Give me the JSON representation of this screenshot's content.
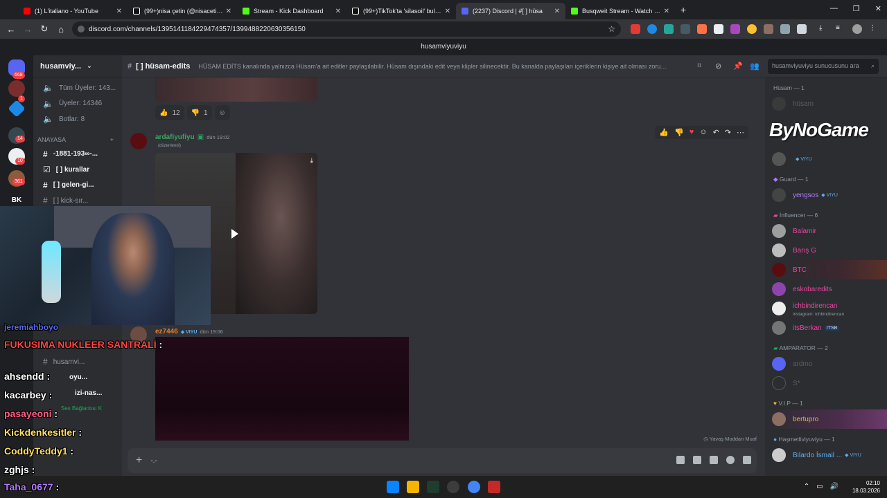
{
  "browser": {
    "tabs": [
      {
        "title": "(1) L'italiano - YouTube",
        "color": "#ff0000"
      },
      {
        "title": "(99+)nisa çetin (@nisacetin0_) |",
        "color": "#111111"
      },
      {
        "title": "Stream - Kick Dashboard",
        "color": "#53fc18"
      },
      {
        "title": "(99+)TikTok'ta 'silasoil' bulabili",
        "color": "#111111"
      },
      {
        "title": "(2237) Discord | #[ ] hüsa",
        "color": "#5865f2"
      },
      {
        "title": "Busqweit Stream - Watch Live o",
        "color": "#53fc18"
      }
    ],
    "url": "discord.com/channels/1395141184229474357/1399488220630356150"
  },
  "discord": {
    "window_title": "husamviyuviyu",
    "server_name": "husamviy...",
    "channels": [
      {
        "label": "Tüm Üyeler: 143..."
      },
      {
        "label": "Üyeler: 14346"
      },
      {
        "label": "Botlar: 8"
      }
    ],
    "category": "ANAYASA",
    "text_channels": [
      {
        "label": "-1881-193∞-..."
      },
      {
        "label": "[ ] kurallar"
      },
      {
        "label": "[ ] gelen-gi..."
      },
      {
        "label": "[ ] kick-sır..."
      }
    ],
    "lower_channels": [
      {
        "label": "husamvi..."
      },
      {
        "label": "oyu..."
      },
      {
        "label": "izi-nas..."
      }
    ],
    "voice_status": "Ses Bağlantısı K",
    "header": {
      "channel": "[ ] hüsam-edits",
      "topic": "HÜSAM EDİTS kanalında yalnızca Hüsam'a ait editler paylaşılabilir. Hüsam dışındaki edit veya klipler silinecektir. Bu kanalda paylaşılan içeriklerin kişiye ait olması zorunl...",
      "search_placeholder": "husamviyuviyu sunucusunu ara"
    },
    "reactions": [
      {
        "count": "12"
      },
      {
        "count": "1"
      }
    ],
    "messages": [
      {
        "author": "ardafiyufiyu",
        "time": "dün 19:02",
        "edited": "(düzenlendi)",
        "color": "#3ba55d"
      },
      {
        "author": "ez7446",
        "badge": "VIYU",
        "time": "dün 19:06",
        "color": "#e67e22"
      }
    ],
    "slowmode": "Yavaş Moddan Muaf",
    "input_text": "-.-",
    "members": {
      "roles": [
        {
          "name": "Hüsam — 1",
          "members": [
            {
              "name": "hüsam",
              "color": "#5c5c5c"
            }
          ]
        },
        {
          "name": "",
          "members": [
            {
              "name": "",
              "tag": "VIYU",
              "color": "#5c5c5c"
            }
          ]
        },
        {
          "name": "Guard — 1",
          "members": [
            {
              "name": "yengsos",
              "tag": "VIYU",
              "color": "#b07bff"
            }
          ]
        },
        {
          "name": "İnfluencer — 6",
          "members": [
            {
              "name": "Balamir",
              "color": "#eb459e"
            },
            {
              "name": "Barış G",
              "color": "#eb459e"
            },
            {
              "name": "BTC",
              "color": "#eb459e"
            },
            {
              "name": "eskobaredits",
              "color": "#eb459e"
            },
            {
              "name": "ichbindirencan",
              "sub": "instagram: ichbindirencan",
              "color": "#eb459e"
            },
            {
              "name": "itsBerkan",
              "tag": "ITSB",
              "color": "#eb459e"
            }
          ]
        },
        {
          "name": "AMPARATOR — 2",
          "members": [
            {
              "name": "ardmo",
              "color": "#5c5c5c"
            },
            {
              "name": "S*",
              "color": "#5c5c5c"
            }
          ]
        },
        {
          "name": "V.I.P — 1",
          "members": [
            {
              "name": "bertupro",
              "color": "#f0b232"
            }
          ]
        },
        {
          "name": "Haşmetliviyuviyu — 1",
          "members": [
            {
              "name": "Bilardo İsmail ...",
              "tag": "VIYU",
              "color": "#5dadec"
            }
          ]
        }
      ]
    },
    "sponsor": "ByNoGame"
  },
  "stream_chat": [
    {
      "user": "jeremiahboyo",
      "text": "",
      "color": "#5865f2"
    },
    {
      "user": "FUKUSIMA NUKLEER SANTRALİ",
      "text": ":",
      "color": "#ff4444"
    },
    {
      "user": "ahsendd",
      "text": ":",
      "color": "#ffffff"
    },
    {
      "user": "kacarbey",
      "text": ":",
      "color": "#ffffff"
    },
    {
      "user": "pasayeoni",
      "text": ":",
      "color": "#ff5e8a"
    },
    {
      "user": "Kickdenkesitler",
      "text": ":",
      "color": "#ffe066"
    },
    {
      "user": "CoddyTeddy1",
      "text": ":",
      "color": "#ffe066"
    },
    {
      "user": "zghjs",
      "text": ":",
      "color": "#ffffff"
    },
    {
      "user": "Taha_0677",
      "text": ":",
      "color": "#b07bff"
    }
  ],
  "guild_badges": [
    "668",
    "1",
    "14",
    "10",
    "361"
  ],
  "guild_label": "BK",
  "taskbar": {
    "time": "02:10",
    "date": "18.03.2026"
  }
}
